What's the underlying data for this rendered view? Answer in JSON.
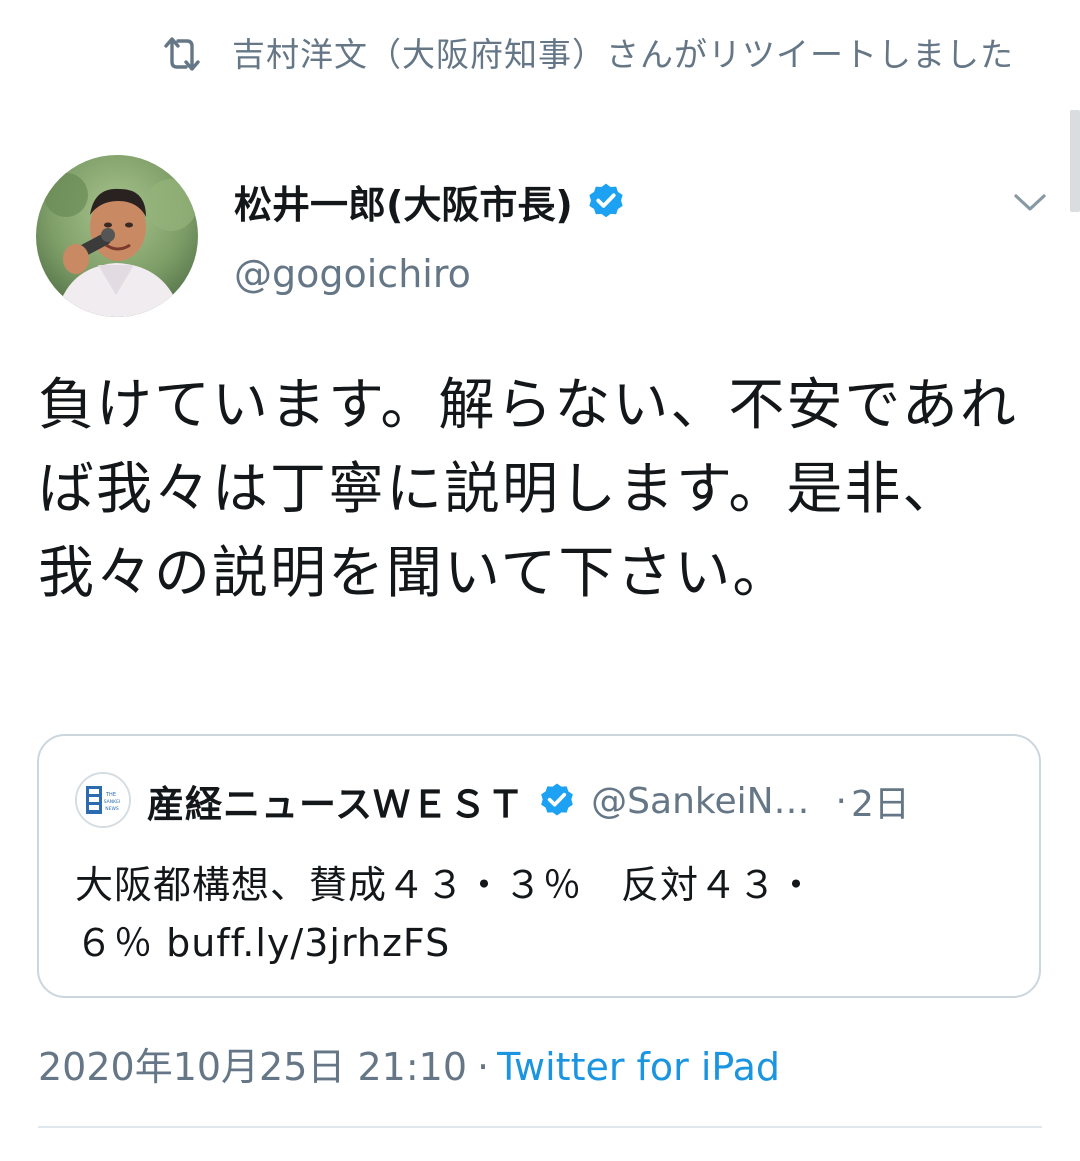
{
  "retweet": {
    "text": "吉村洋文（大阪府知事）さんがリツイートしました",
    "icon": "retweet-icon"
  },
  "author": {
    "name": "松井一郎(大阪市長)",
    "handle": "@gogoichiro",
    "verified": true
  },
  "tweet": {
    "text": "負けています。解らない、不安であれば我々は丁寧に説明します。是非、我々の説明を聞いて下さい。"
  },
  "quote": {
    "name": "産経ニュースＷＥＳＴ",
    "handle": "@SankeiN…",
    "dot": "·",
    "time": "2日",
    "text": "大阪都構想、賛成４３・３％　反対４３・\n６％ buff.ly/3jrhzFS",
    "avatar_text": "THE SANKEI NEWS"
  },
  "meta": {
    "datetime": "2020年10月25日 21:10",
    "separator": "·",
    "source": "Twitter for iPad"
  },
  "colors": {
    "verified": "#1da1f2",
    "secondary_text": "#657786",
    "link": "#1b95e0",
    "border": "#ccd6dd"
  }
}
